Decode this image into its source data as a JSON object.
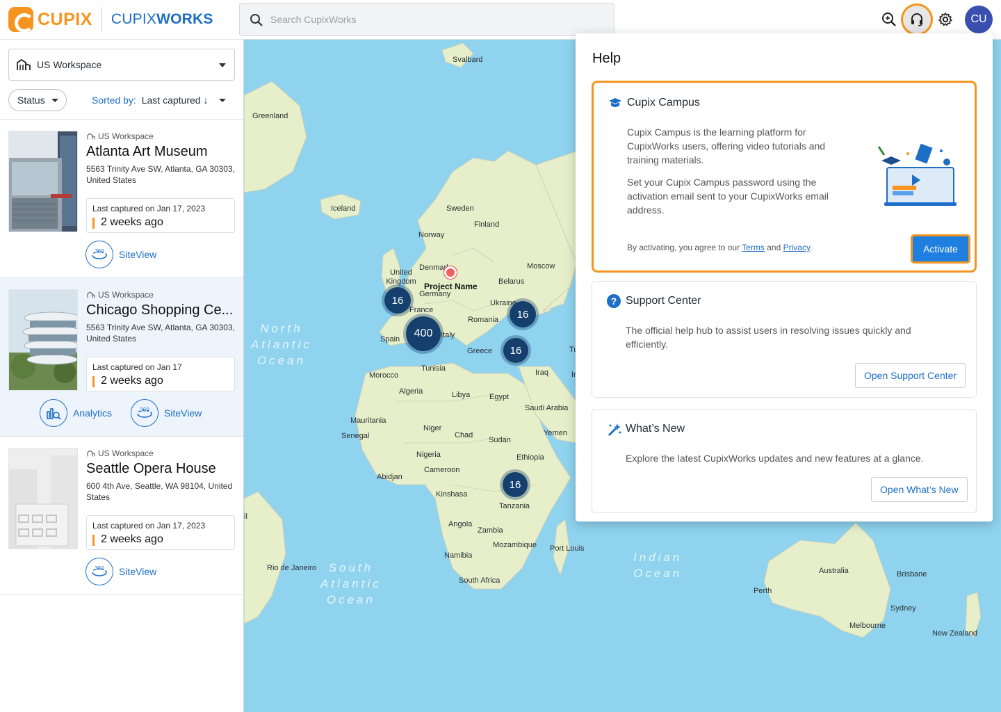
{
  "header": {
    "logo_word": "CUPIX",
    "logo_product_light": "CUPIX",
    "logo_product_bold": "WORKS",
    "search_placeholder": "Search CupixWorks",
    "avatar_initials": "CU"
  },
  "sidebar": {
    "workspace": "US Workspace",
    "status_filter": "Status",
    "sort_label": "Sorted by:",
    "sort_value": "Last captured",
    "sort_arrow": "↓",
    "cards": [
      {
        "workspace": "US Workspace",
        "title": "Atlanta Art Museum",
        "address": "5563 Trinity Ave SW, Atlanta, GA 30303, United States",
        "captured_label": "Last captured on Jan 17, 2023",
        "captured_ago": "2 weeks ago",
        "actions": [
          "SiteView"
        ]
      },
      {
        "workspace": "US Workspace",
        "title": "Chicago Shopping Ce...",
        "address": "5563 Trinity Ave SW, Atlanta, GA 30303, United States",
        "captured_label": "Last captured on Jan 17",
        "captured_ago": "2 weeks ago",
        "actions": [
          "Analytics",
          "SiteView"
        ]
      },
      {
        "workspace": "US Workspace",
        "title": "Seattle Opera House",
        "address": "600 4th Ave, Seattle, WA 98104, United States",
        "captured_label": "Last captured on Jan 17, 2023",
        "captured_ago": "2 weeks ago",
        "actions": [
          "SiteView"
        ]
      }
    ]
  },
  "map": {
    "labels": [
      "Svalbard",
      "Greenland",
      "Iceland",
      "Sweden",
      "Finland",
      "Norway",
      "United Kingdom",
      "Denmark",
      "Project Name",
      "Germany",
      "Belarus",
      "Moscow",
      "Ukraine",
      "France",
      "Romania",
      "Spain",
      "Italy",
      "Greece",
      "Tunisia",
      "Morocco",
      "Algeria",
      "Libya",
      "Egypt",
      "Saudi Arabia",
      "Iraq",
      "Mauritania",
      "Senegal",
      "Niger",
      "Chad",
      "Sudan",
      "Yemen",
      "Nigeria",
      "Ethiopia",
      "Cameroon",
      "Abidjan",
      "Kinshasa",
      "Tanzania",
      "Angola",
      "Zambia",
      "Namibia",
      "Mozambique",
      "South Africa",
      "Port Louis",
      "Rio de Janeiro",
      "Australia",
      "Brisbane",
      "Perth",
      "Sydney",
      "Melbourne",
      "New Zealand",
      "Ir",
      "Tu",
      "il"
    ],
    "oceans": [
      "North Atlantic Ocean",
      "South Atlantic Ocean",
      "Indian Ocean"
    ],
    "clusters": [
      "16",
      "400",
      "16",
      "16",
      "16"
    ],
    "pin_label": "Project Name",
    "land_color": "#e6efc9",
    "water_color": "#8fd3ef"
  },
  "help": {
    "title": "Help",
    "campus": {
      "title": "Cupix Campus",
      "p1": "Cupix Campus is the learning platform for CupixWorks users, offering video tutorials and training materials.",
      "p2": "Set your Cupix Campus password using the activation email sent to your CupixWorks email address.",
      "agree_prefix": "By activating, you agree to our",
      "terms": "Terms",
      "and": "and",
      "privacy": "Privacy",
      "period": ".",
      "button": "Activate"
    },
    "support": {
      "title": "Support Center",
      "text": "The official help hub to assist users in resolving issues quickly and efficiently.",
      "button": "Open Support Center"
    },
    "whatsnew": {
      "title": "What’s New",
      "text": "Explore the latest CupixWorks updates and new features at a glance.",
      "button": "Open What’s New"
    }
  },
  "colors": {
    "brand_orange": "#f5951f",
    "brand_blue": "#1d6ec7",
    "cluster": "#15406e",
    "active_card": "#eef4fb"
  }
}
